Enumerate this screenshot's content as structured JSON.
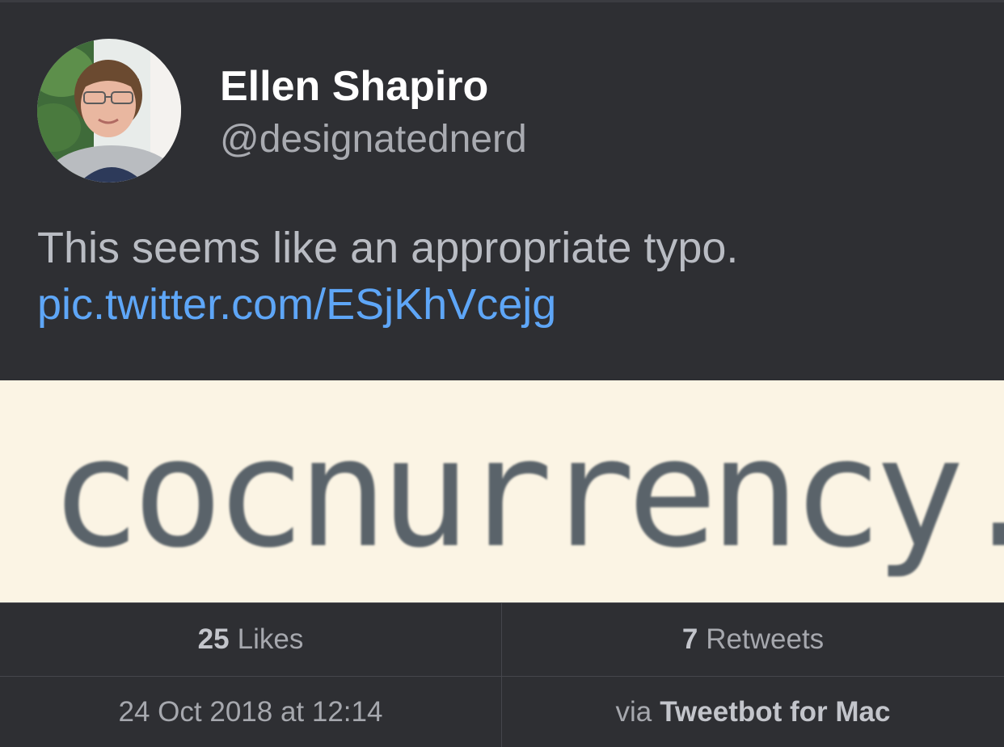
{
  "author": {
    "name": "Ellen Shapiro",
    "handle": "@designatednerd"
  },
  "tweet": {
    "text": "This seems like an appropriate typo.",
    "link": "pic.twitter.com/ESjKhVcejg"
  },
  "media": {
    "text": "cocnurrency."
  },
  "stats": {
    "likes_count": "25",
    "likes_label": "Likes",
    "retweets_count": "7",
    "retweets_label": "Retweets",
    "timestamp": "24 Oct 2018 at 12:14",
    "via_label": "via",
    "client": "Tweetbot for Mac"
  },
  "colors": {
    "background": "#2e2f33",
    "link": "#5ea6f7",
    "media_background": "#fbf4e4"
  }
}
